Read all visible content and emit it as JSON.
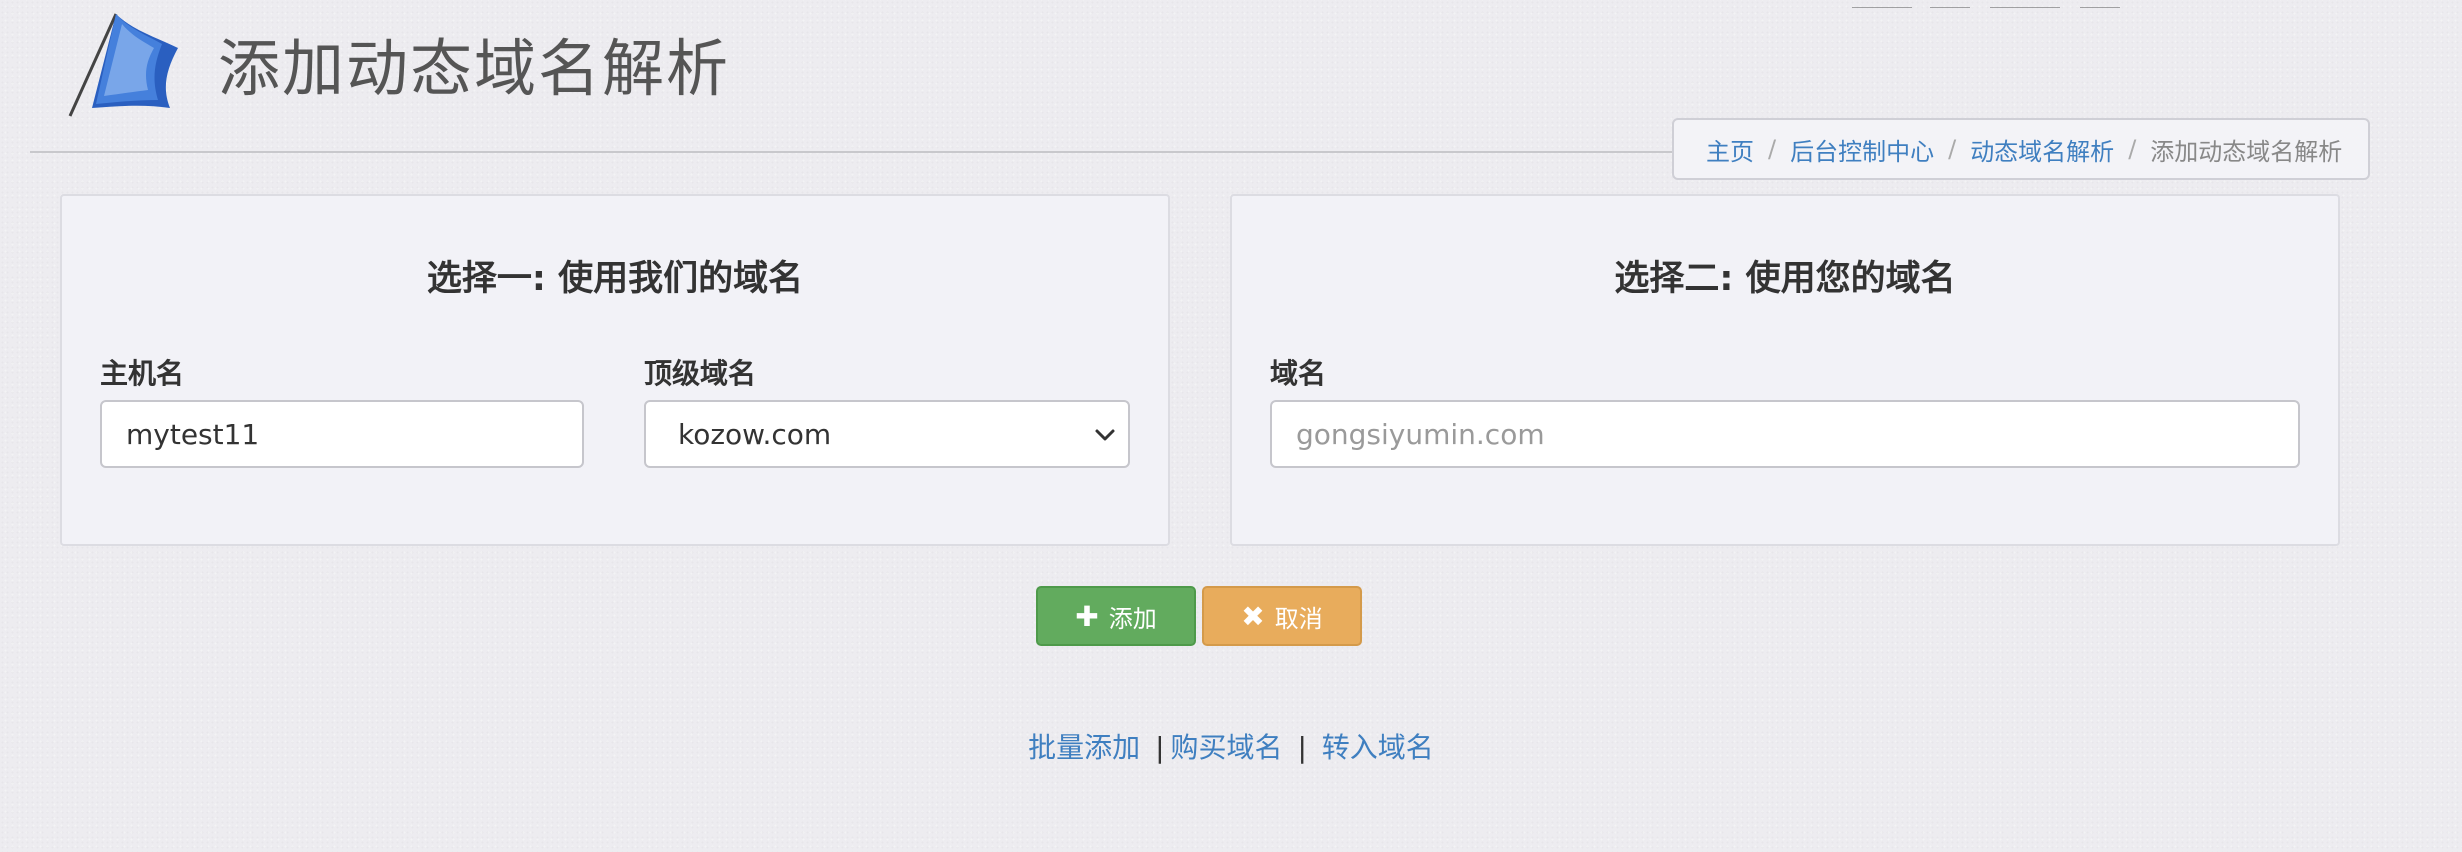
{
  "page": {
    "title": "添加动态域名解析"
  },
  "breadcrumb": {
    "items": [
      "主页",
      "后台控制中心",
      "动态域名解析"
    ],
    "current": "添加动态域名解析"
  },
  "option_one": {
    "title_bold": "选择一",
    "title_rest": ": 使用我们的域名",
    "hostname_label": "主机名",
    "hostname_value": "mytest11",
    "tld_label": "顶级域名",
    "tld_selected": "kozow.com"
  },
  "option_two": {
    "title_bold": "选择二",
    "title_rest": ": 使用您的域名",
    "domain_label": "域名",
    "domain_placeholder": "gongsiyumin.com"
  },
  "buttons": {
    "add": "添加",
    "cancel": "取消"
  },
  "links": {
    "batch_add": "批量添加",
    "buy_domain": "购买域名",
    "transfer_domain": "转入域名",
    "separator": "|"
  },
  "colors": {
    "link": "#3f7fc0",
    "add_button": "#62ab5e",
    "cancel_button": "#e8ac5c"
  }
}
